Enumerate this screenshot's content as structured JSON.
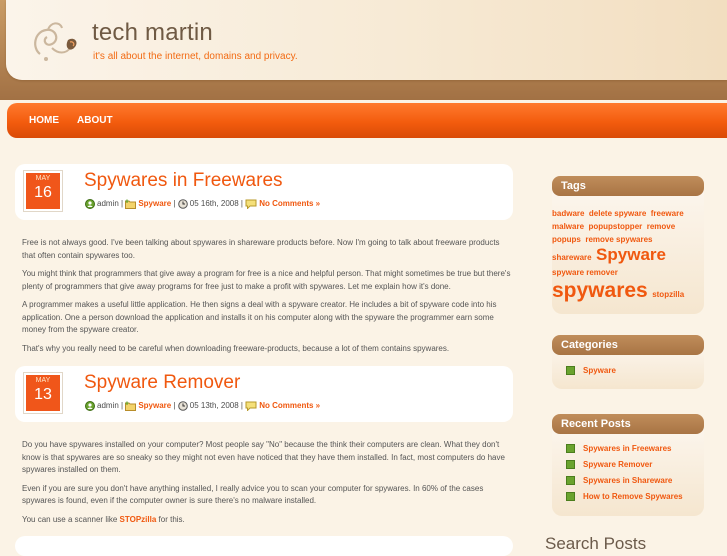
{
  "site": {
    "title": "tech martin",
    "tagline": "it's all about the internet, domains and privacy."
  },
  "nav": [
    {
      "label": "HOME"
    },
    {
      "label": "ABOUT"
    }
  ],
  "posts": [
    {
      "month": "MAY",
      "day": "16",
      "title": "Spywares in Freewares",
      "author": "admin",
      "category": "Spyware",
      "date": "05 16th, 2008",
      "comments": "No Comments »",
      "paragraphs": [
        "Free is not always good. I've been talking about spywares in shareware products before. Now I'm going to talk about freeware products that often contain spywares too.",
        "You might think that programmers that give away a program for free is a nice and helpful person. That might sometimes be true but there's plenty of programmers that give away programs for free just to make a profit with spywares. Let me explain how it's done.",
        "A programmer makes a useful little application. He then signs a deal with a spyware creator. He includes a bit of spyware code into his application. One a person download the application and installs it on his computer along with the spyware the programmer earn some money from the spyware creator.",
        "That's why you really need to be careful when downloading freeware-products, because a lot of them contains spywares."
      ]
    },
    {
      "month": "MAY",
      "day": "13",
      "title": "Spyware Remover",
      "author": "admin",
      "category": "Spyware",
      "date": "05 13th, 2008",
      "comments": "No Comments »",
      "paragraphs": [
        "Do you have spywares installed on your computer? Most people say \"No\" because the think their computers are clean. What they don't know is that spywares are so sneaky so they might not even have noticed that they have them installed. In fact, most computers do have spywares installed on them.",
        "Even if you are sure you don't have anything installed, I really advice you to scan your computer for spywares. In 60% of the cases spywares is found, even if the computer owner is sure there's no malware installed."
      ],
      "last_para_prefix": "You can use a scanner like ",
      "last_para_link": "STOPzilla",
      "last_para_suffix": " for this."
    }
  ],
  "sidebar": {
    "tags_title": "Tags",
    "tags": [
      {
        "label": "badware",
        "size": 8
      },
      {
        "label": "delete spyware",
        "size": 8
      },
      {
        "label": "freeware",
        "size": 8
      },
      {
        "label": "malware",
        "size": 8
      },
      {
        "label": "popupstopper",
        "size": 8
      },
      {
        "label": "remove popups",
        "size": 8
      },
      {
        "label": "remove spywares",
        "size": 8
      },
      {
        "label": "shareware",
        "size": 8
      },
      {
        "label": "Spyware",
        "size": 17
      },
      {
        "label": "spyware remover",
        "size": 8
      },
      {
        "label": "spywares",
        "size": 21
      },
      {
        "label": "stopzilla",
        "size": 8
      }
    ],
    "categories_title": "Categories",
    "categories": [
      "Spyware"
    ],
    "recent_title": "Recent Posts",
    "recent": [
      "Spywares in Freewares",
      "Spyware Remover",
      "Spywares in Shareware",
      "How to Remove Spywares"
    ],
    "search_title": "Search Posts"
  },
  "colors": {
    "accent": "#f0580f",
    "nav": "#f35c0e",
    "widget_header": "#b07c4c"
  }
}
